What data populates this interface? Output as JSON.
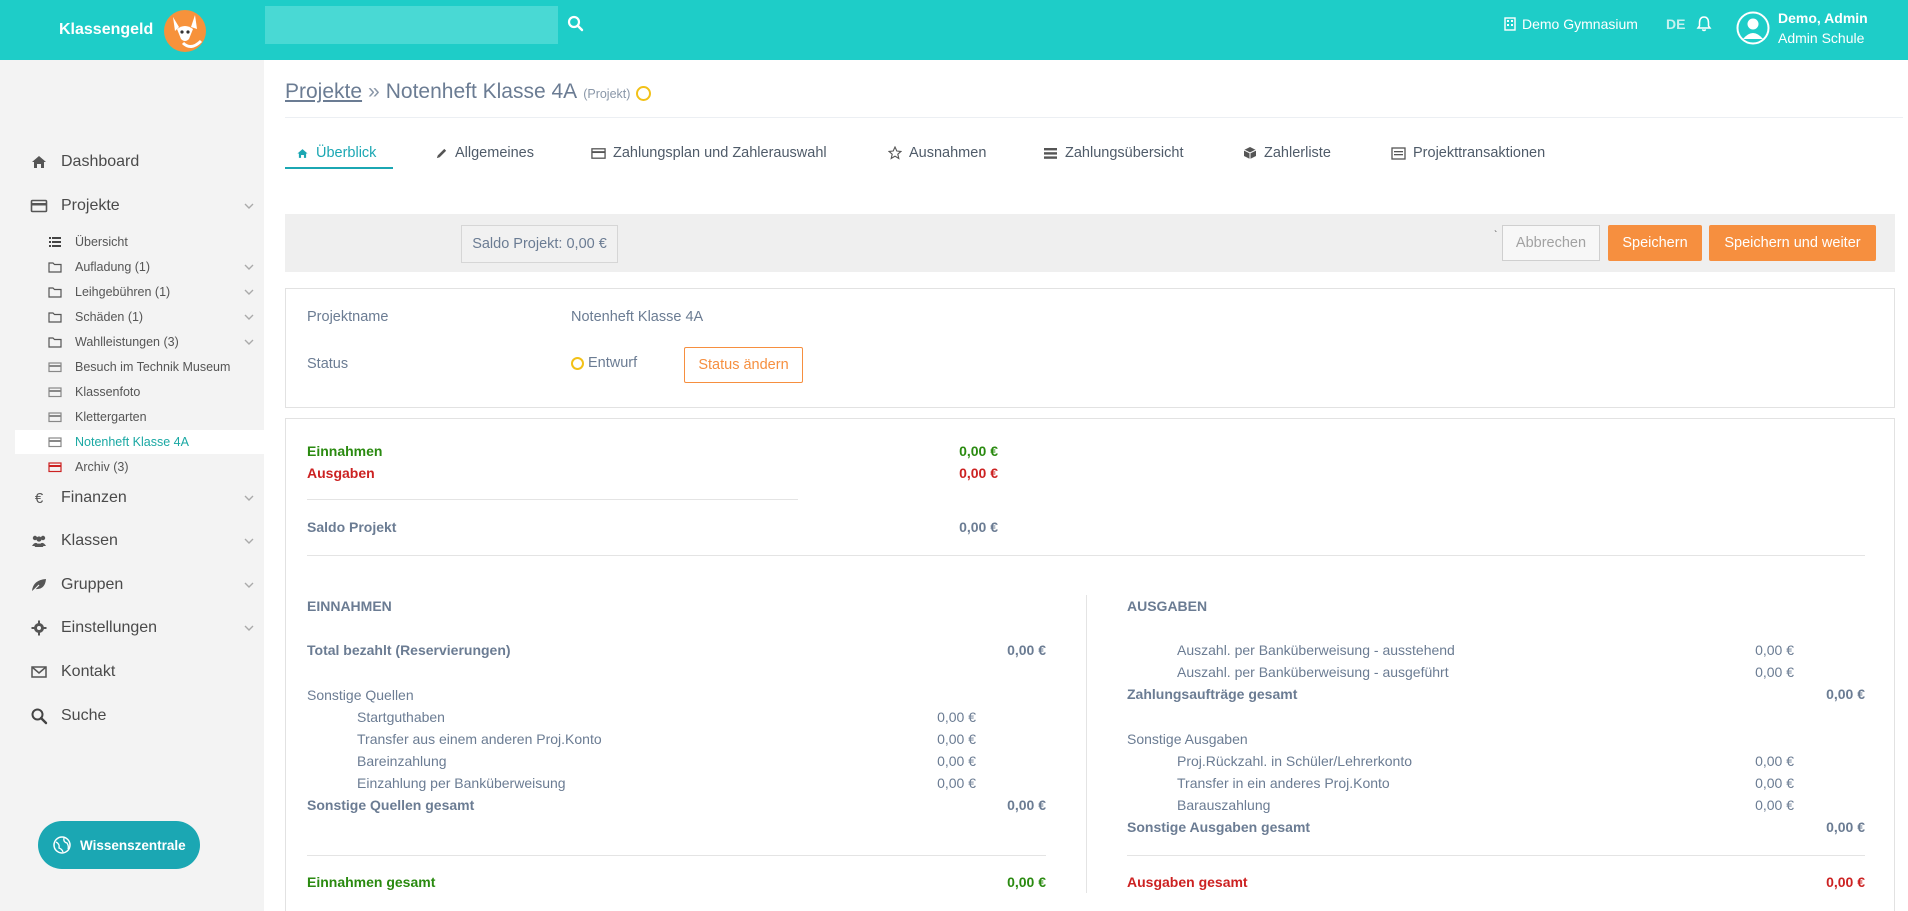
{
  "header": {
    "brand": "Klassengeld",
    "search": {
      "value": "",
      "placeholder": ""
    },
    "school": "Demo Gymnasium",
    "language": "DE",
    "user_name": "Demo, Admin",
    "user_role": "Admin Schule",
    "colors": {
      "topbar": "#1ecdc8",
      "accent": "#1ba7b3",
      "orange": "#f68f3f"
    }
  },
  "sidebar": {
    "items": [
      {
        "label": "Dashboard",
        "icon": "home-icon"
      },
      {
        "label": "Projekte",
        "icon": "card-icon"
      },
      {
        "label": "Finanzen",
        "icon": "euro-icon"
      },
      {
        "label": "Klassen",
        "icon": "users-icon"
      },
      {
        "label": "Gruppen",
        "icon": "leaf-icon"
      },
      {
        "label": "Einstellungen",
        "icon": "gear-icon"
      },
      {
        "label": "Kontakt",
        "icon": "envelope-icon"
      },
      {
        "label": "Suche",
        "icon": "search-icon"
      }
    ],
    "projects_sub": [
      {
        "label": "Übersicht",
        "icon": "list-icon"
      },
      {
        "label": "Aufladung (1)",
        "icon": "folder-icon"
      },
      {
        "label": "Leihgebühren (1)",
        "icon": "folder-icon"
      },
      {
        "label": "Schäden (1)",
        "icon": "folder-icon"
      },
      {
        "label": "Wahlleistungen (3)",
        "icon": "folder-icon"
      },
      {
        "label": "Besuch im Technik Museum",
        "icon": "card-icon"
      },
      {
        "label": "Klassenfoto",
        "icon": "card-icon"
      },
      {
        "label": "Klettergarten",
        "icon": "card-icon"
      },
      {
        "label": "Notenheft Klasse 4A",
        "icon": "card-icon"
      },
      {
        "label": "Archiv (3)",
        "icon": "card-icon"
      }
    ],
    "knowledge_button": "Wissenszentrale"
  },
  "breadcrumb": {
    "root": "Projekte",
    "separator": "»",
    "title": "Notenheft Klasse 4A",
    "type": "(Projekt)"
  },
  "tabs": [
    {
      "label": "Überblick",
      "icon": "home-icon"
    },
    {
      "label": "Allgemeines",
      "icon": "pencil-icon"
    },
    {
      "label": "Zahlungsplan und Zahlerauswahl",
      "icon": "card-icon"
    },
    {
      "label": "Ausnahmen",
      "icon": "star-icon"
    },
    {
      "label": "Zahlungsübersicht",
      "icon": "list-icon"
    },
    {
      "label": "Zahlerliste",
      "icon": "cube-icon"
    },
    {
      "label": "Projekttransaktionen",
      "icon": "receipt-icon"
    }
  ],
  "toolbar": {
    "saldo": "Saldo Projekt: 0,00 €",
    "tick": "`",
    "cancel": "Abbrechen",
    "save": "Speichern",
    "save_next": "Speichern und weiter"
  },
  "project": {
    "name_label": "Projektname",
    "name_value": "Notenheft Klasse 4A",
    "status_label": "Status",
    "status_value": "Entwurf",
    "status_button": "Status ändern"
  },
  "summary": {
    "einnahmen_label": "Einnahmen",
    "einnahmen_value": "0,00 €",
    "ausgaben_label": "Ausgaben",
    "ausgaben_value": "0,00 €",
    "saldo_label": "Saldo Projekt",
    "saldo_value": "0,00 €"
  },
  "income": {
    "heading": "EINNAHMEN",
    "total_paid_label": "Total bezahlt (Reservierungen)",
    "total_paid_value": "0,00 €",
    "other_heading": "Sonstige Quellen",
    "other_items": [
      {
        "label": "Startguthaben",
        "value": "0,00 €"
      },
      {
        "label": "Transfer aus einem anderen Proj.Konto",
        "value": "0,00 €"
      },
      {
        "label": "Bareinzahlung",
        "value": "0,00 €"
      },
      {
        "label": "Einzahlung per Banküberweisung",
        "value": "0,00 €"
      }
    ],
    "other_total_label": "Sonstige Quellen gesamt",
    "other_total_value": "0,00 €",
    "grand_label": "Einnahmen gesamt",
    "grand_value": "0,00 €"
  },
  "expenses": {
    "heading": "AUSGABEN",
    "payout_items": [
      {
        "label": "Auszahl. per Banküberweisung - ausstehend",
        "value": "0,00 €"
      },
      {
        "label": "Auszahl. per Banküberweisung - ausgeführt",
        "value": "0,00 €"
      }
    ],
    "orders_total_label": "Zahlungsaufträge gesamt",
    "orders_total_value": "0,00 €",
    "other_heading": "Sonstige Ausgaben",
    "other_items": [
      {
        "label": "Proj.Rückzahl. in Schüler/Lehrerkonto",
        "value": "0,00 €"
      },
      {
        "label": "Transfer in ein anderes Proj.Konto",
        "value": "0,00 €"
      },
      {
        "label": "Barauszahlung",
        "value": "0,00 €"
      }
    ],
    "other_total_label": "Sonstige Ausgaben gesamt",
    "other_total_value": "0,00 €",
    "grand_label": "Ausgaben gesamt",
    "grand_value": "0,00 €"
  }
}
